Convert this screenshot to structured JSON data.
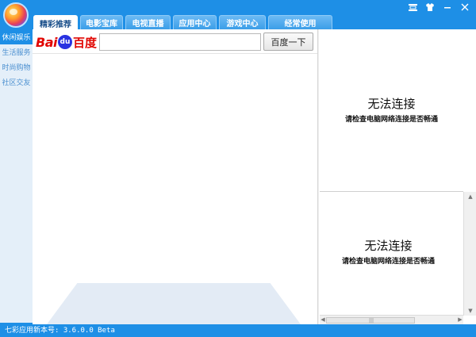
{
  "window": {
    "controls": [
      "≡",
      "—",
      "✕"
    ]
  },
  "tabs": [
    {
      "label": "精彩推荐",
      "active": true
    },
    {
      "label": "电影宝库",
      "active": false
    },
    {
      "label": "电视直播",
      "active": false
    },
    {
      "label": "应用中心",
      "active": false
    },
    {
      "label": "游戏中心",
      "active": false
    },
    {
      "label": "经常使用",
      "active": false
    }
  ],
  "sidebar": {
    "items": [
      {
        "label": "休闲娱乐",
        "active": true
      },
      {
        "label": "生活服务",
        "active": false
      },
      {
        "label": "时尚购物",
        "active": false
      },
      {
        "label": "社区交友",
        "active": false
      }
    ]
  },
  "search": {
    "logo_bai": "Bai",
    "logo_du": "du",
    "logo_cn": "百度",
    "value": "",
    "button_label": "百度一下"
  },
  "panels": [
    {
      "title": "无法连接",
      "message": "请检查电脑网络连接是否畅通"
    },
    {
      "title": "无法连接",
      "message": "请检查电脑网络连接是否畅通"
    }
  ],
  "status": {
    "text": "七彩应用新本号: 3.6.0.0 Beta"
  },
  "colors": {
    "brand_blue": "#1e8fe6",
    "sidebar_bg": "#e4eff9",
    "baidu_red": "#e10602",
    "baidu_blue": "#2932e1"
  },
  "icons": [
    "app-logo-icon",
    "menu-icon",
    "skin-icon",
    "minimize-icon",
    "close-icon"
  ]
}
